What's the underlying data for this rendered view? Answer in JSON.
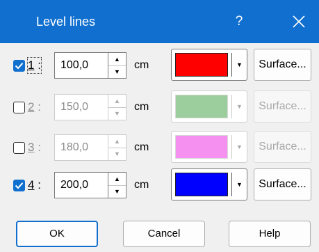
{
  "window": {
    "title": "Level lines",
    "help_label": "?"
  },
  "rows": [
    {
      "index": "1",
      "separator": ":",
      "checked": true,
      "enabled": true,
      "focused": true,
      "value": "100,0",
      "unit": "cm",
      "color": "#ff0000",
      "surface_label": "Surface..."
    },
    {
      "index": "2",
      "separator": ":",
      "checked": false,
      "enabled": false,
      "focused": false,
      "value": "150,0",
      "unit": "cm",
      "color": "#9ccd9c",
      "surface_label": "Surface..."
    },
    {
      "index": "3",
      "separator": ":",
      "checked": false,
      "enabled": false,
      "focused": false,
      "value": "180,0",
      "unit": "cm",
      "color": "#f58ff0",
      "surface_label": "Surface..."
    },
    {
      "index": "4",
      "separator": ":",
      "checked": true,
      "enabled": true,
      "focused": false,
      "value": "200,0",
      "unit": "cm",
      "color": "#0000ff",
      "surface_label": "Surface..."
    }
  ],
  "buttons": {
    "ok": "OK",
    "cancel": "Cancel",
    "help": "Help"
  },
  "colors": {
    "accent": "#1170cf",
    "window_bg": "#f0f0f0"
  },
  "icons": {
    "close": "close-icon",
    "check": "checkmark-icon",
    "spin_up": "triangle-up-icon",
    "spin_down": "triangle-down-icon",
    "dropdown": "triangle-down-icon"
  }
}
